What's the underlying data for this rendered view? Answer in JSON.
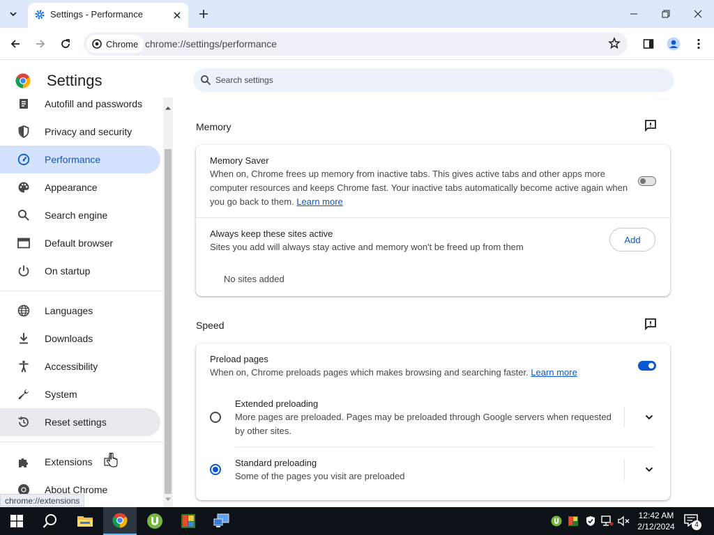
{
  "browser": {
    "tab_title": "Settings - Performance",
    "chip_label": "Chrome",
    "url": "chrome://settings/performance",
    "status_url": "chrome://extensions"
  },
  "settings": {
    "title": "Settings",
    "search_placeholder": "Search settings"
  },
  "sidebar": {
    "items": [
      {
        "label": "Autofill and passwords",
        "icon": "autofill-icon"
      },
      {
        "label": "Privacy and security",
        "icon": "shield-icon"
      },
      {
        "label": "Performance",
        "icon": "speedometer-icon",
        "active": true
      },
      {
        "label": "Appearance",
        "icon": "palette-icon"
      },
      {
        "label": "Search engine",
        "icon": "search-icon"
      },
      {
        "label": "Default browser",
        "icon": "browser-window-icon"
      },
      {
        "label": "On startup",
        "icon": "power-icon"
      },
      {
        "label": "Languages",
        "icon": "globe-icon"
      },
      {
        "label": "Downloads",
        "icon": "download-icon"
      },
      {
        "label": "Accessibility",
        "icon": "accessibility-icon"
      },
      {
        "label": "System",
        "icon": "wrench-icon"
      },
      {
        "label": "Reset settings",
        "icon": "reset-icon",
        "hover": true
      },
      {
        "label": "Extensions",
        "icon": "puzzle-icon"
      },
      {
        "label": "About Chrome",
        "icon": "chrome-icon"
      }
    ]
  },
  "memory": {
    "section_title": "Memory",
    "saver_title": "Memory Saver",
    "saver_desc_1": "When on, Chrome frees up memory from inactive tabs. This gives active tabs and other apps more",
    "saver_desc_2": "computer resources and keeps Chrome fast. Your inactive tabs automatically become active again when",
    "saver_desc_3": "you go back to them.",
    "learn_more": "Learn more",
    "saver_enabled": false,
    "keep_title": "Always keep these sites active",
    "keep_desc": "Sites you add will always stay active and memory won't be freed up from them",
    "add_label": "Add",
    "no_sites": "No sites added"
  },
  "speed": {
    "section_title": "Speed",
    "preload_title": "Preload pages",
    "preload_desc": "When on, Chrome preloads pages which makes browsing and searching faster.",
    "learn_more": "Learn more",
    "preload_enabled": true,
    "extended_title": "Extended preloading",
    "extended_desc_1": "More pages are preloaded. Pages may be preloaded through Google servers when requested",
    "extended_desc_2": "by other sites.",
    "standard_title": "Standard preloading",
    "standard_desc": "Some of the pages you visit are preloaded",
    "selected_option": "Standard preloading"
  },
  "taskbar": {
    "time": "12:42 AM",
    "date": "2/12/2024",
    "notification_count": "4"
  },
  "colors": {
    "accent": "#0b57d0",
    "active_nav_bg": "#d3e3fd",
    "tabstrip_bg": "#dee8fb",
    "taskbar_bg": "#0c1218"
  }
}
